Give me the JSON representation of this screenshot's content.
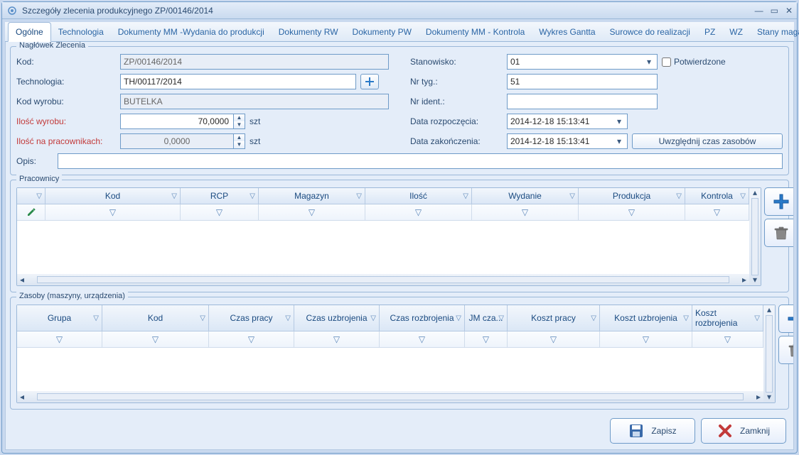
{
  "window": {
    "title": "Szczegóły zlecenia produkcyjnego ZP/00146/2014"
  },
  "tabs": {
    "items": [
      "Ogólne",
      "Technologia",
      "Dokumenty MM -Wydania do produkcji",
      "Dokumenty RW",
      "Dokumenty PW",
      "Dokumenty MM - Kontrola",
      "Wykres Gantta",
      "Surowce do realizacji",
      "PZ",
      "WZ",
      "Stany magazynowe"
    ],
    "active_index": 0
  },
  "header": {
    "legend": "Nagłówek Zlecenia",
    "labels": {
      "kod": "Kod:",
      "technologia": "Technologia:",
      "kod_wyrobu": "Kod wyrobu:",
      "ilosc_wyrobu": "Ilość wyrobu:",
      "ilosc_na_pracownikach": "Ilość na pracownikach:",
      "opis": "Opis:",
      "stanowisko": "Stanowisko:",
      "nr_tyg": "Nr tyg.:",
      "nr_ident": "Nr ident.:",
      "data_rozp": "Data rozpoczęcia:",
      "data_zak": "Data zakończenia:",
      "potwierdzone": "Potwierdzone"
    },
    "values": {
      "kod": "ZP/00146/2014",
      "technologia": "TH/00117/2014",
      "kod_wyrobu": "BUTELKA",
      "ilosc_wyrobu": "70,0000",
      "ilosc_na_pracownikach": "0,0000",
      "opis": "",
      "stanowisko": "01",
      "nr_tyg": "51",
      "nr_ident": "",
      "data_rozp": "2014-12-18 15:13:41",
      "data_zak": "2014-12-18 15:13:41",
      "unit": "szt"
    },
    "buttons": {
      "uwzglednij": "Uwzględnij czas zasobów"
    }
  },
  "grid1": {
    "legend": "Pracownicy",
    "cols": [
      "",
      "Kod",
      "RCP",
      "Magazyn",
      "Ilość",
      "Wydanie",
      "Produkcja",
      "Kontrola"
    ],
    "widths": [
      40,
      190,
      110,
      150,
      150,
      150,
      150,
      90
    ]
  },
  "grid2": {
    "legend": "Zasoby (maszyny, urządzenia)",
    "cols": [
      "Grupa",
      "Kod",
      "Czas pracy",
      "Czas uzbrojenia",
      "Czas rozbrojenia",
      "JM cza...",
      "Koszt pracy",
      "Koszt uzbrojenia",
      "Koszt rozbrojenia"
    ],
    "widths": [
      120,
      150,
      120,
      120,
      120,
      60,
      130,
      130,
      100
    ]
  },
  "footer": {
    "save": "Zapisz",
    "close": "Zamknij"
  }
}
